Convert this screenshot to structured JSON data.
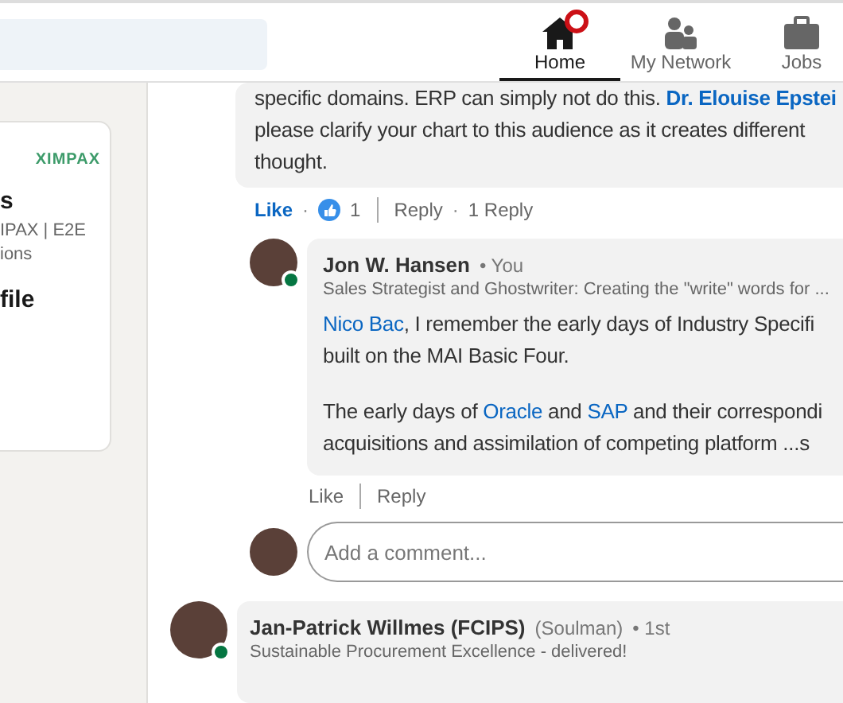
{
  "nav": {
    "items": [
      {
        "label": "Home",
        "selected": true,
        "badge": true
      },
      {
        "label": "My Network",
        "selected": false,
        "badge": false
      },
      {
        "label": "Jobs",
        "selected": false,
        "badge": false
      }
    ]
  },
  "profile_card": {
    "logo": "XIMPAX",
    "lines": [
      {
        "text": "s",
        "kind": "title"
      },
      {
        "text": "IPAX | E2E",
        "kind": "sub"
      },
      {
        "text": "ions",
        "kind": "sub"
      },
      {
        "text": "file",
        "kind": "title"
      }
    ]
  },
  "comments": [
    {
      "paragraphs": [
        [
          [
            {
              "t": "specific domains. ERP can simply not do this. ",
              "mention": false
            },
            {
              "t": "Dr. Elouise Epstei",
              "mention": true
            }
          ],
          [
            {
              "t": " please clarify your chart to this audience as it creates different",
              "mention": false
            }
          ],
          [
            {
              "t": "thought.",
              "mention": false
            }
          ]
        ]
      ],
      "actions": {
        "like": "Like",
        "liked": true,
        "dot": "·",
        "reactions": "1",
        "reply": "Reply",
        "dot_2": "·",
        "replies": "1 Reply"
      }
    },
    {
      "author": "Jon W. Hansen",
      "relation": "• You",
      "online": true,
      "headline": "Sales Strategist and Ghostwriter: Creating the \"write\" words for ...",
      "paragraphs": [
        [
          [
            {
              "t": "Nico Bac",
              "mention": true
            },
            {
              "t": ", I remember the early days of Industry Specifi",
              "mention": false
            }
          ],
          [
            {
              "t": "built on the MAI Basic Four.",
              "mention": false
            }
          ]
        ],
        [
          [
            {
              "t": "The early days of ",
              "mention": false
            },
            {
              "t": "Oracle",
              "mention": true
            },
            {
              "t": " and ",
              "mention": false
            },
            {
              "t": "SAP",
              "mention": true
            },
            {
              "t": " and their correspondi",
              "mention": false
            }
          ],
          [
            {
              "t": "acquisitions and assimilation of competing platform  ...s",
              "mention": false
            }
          ]
        ]
      ],
      "actions": {
        "like": "Like",
        "liked": false,
        "reply": "Reply"
      }
    }
  ],
  "comment_box": {
    "placeholder": "Add a comment..."
  },
  "next_comment": {
    "author": "Jan-Patrick Willmes (FCIPS)",
    "nickname": "(Soulman)",
    "degree": "• 1st",
    "headline": "Sustainable Procurement Excellence - delivered!",
    "online": true
  }
}
